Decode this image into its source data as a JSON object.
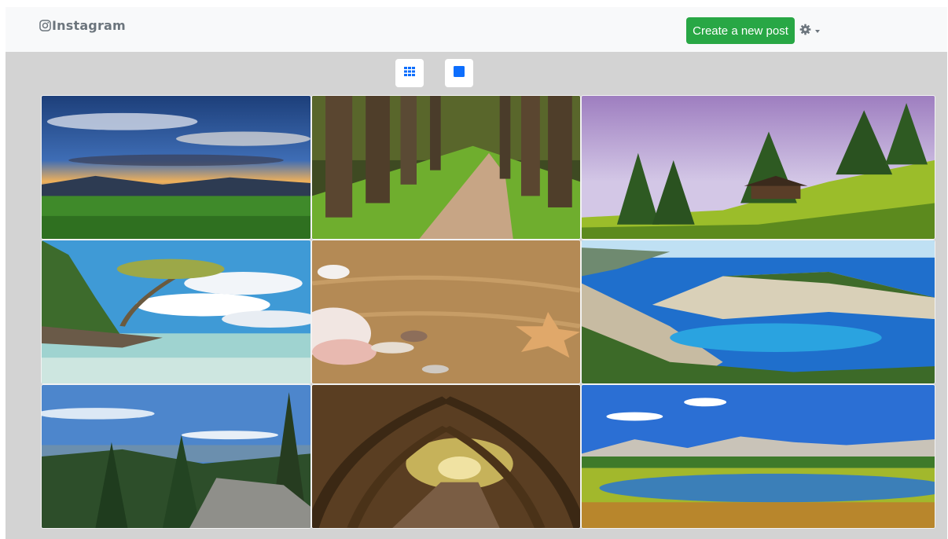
{
  "navbar": {
    "brand_text": "Instagram",
    "brand_icon": "instagram-icon",
    "create_post_label": "Create a new post",
    "settings_icon": "gear-icon",
    "colors": {
      "primary_button": "#28a745",
      "navbar_bg": "#f8f9fa"
    }
  },
  "view_toggles": [
    {
      "icon": "grid-view-icon",
      "active": false
    },
    {
      "icon": "single-view-icon",
      "active": true
    }
  ],
  "colors": {
    "accent": "#0d6efd",
    "page_bg": "#d3d3d3"
  },
  "gallery": {
    "columns": 3,
    "photos": [
      {
        "subject": "sunset-sky-over-meadow"
      },
      {
        "subject": "forest-path-between-trees"
      },
      {
        "subject": "cabin-on-green-hill"
      },
      {
        "subject": "tree-on-tropical-beach"
      },
      {
        "subject": "seashells-and-starfish-on-sand"
      },
      {
        "subject": "coastal-bay-with-turquoise-water"
      },
      {
        "subject": "pine-forest-over-lake"
      },
      {
        "subject": "tree-tunnel-road"
      },
      {
        "subject": "mountain-lake-meadow"
      }
    ]
  }
}
